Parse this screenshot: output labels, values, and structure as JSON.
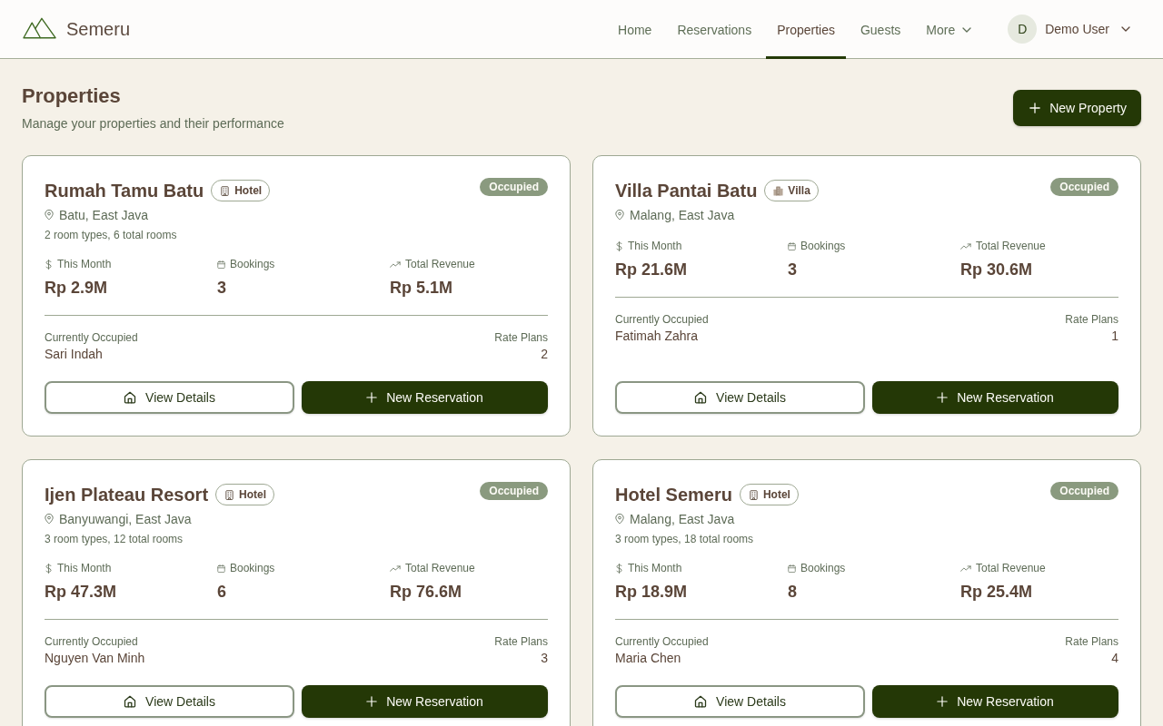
{
  "header": {
    "app_name": "Semeru",
    "nav": [
      {
        "label": "Home",
        "kind": "link",
        "selected": false
      },
      {
        "label": "Reservations",
        "kind": "link",
        "selected": false
      },
      {
        "label": "Properties",
        "kind": "link",
        "selected": true
      },
      {
        "label": "Guests",
        "kind": "link",
        "selected": false
      },
      {
        "label": "More",
        "kind": "menu",
        "selected": false
      }
    ],
    "user": {
      "initial": "D",
      "name": "Demo User"
    }
  },
  "page": {
    "title": "Properties",
    "subtitle": "Manage your properties and their performance",
    "new_button": "New Property"
  },
  "properties": [
    {
      "name": "Rumah Tamu Batu",
      "type": {
        "kind": "hotel",
        "label": "Hotel"
      },
      "status": "Occupied",
      "location": "Batu, East Java",
      "rooms": "2 room types, 6 total rooms",
      "stats": [
        {
          "kind": "money",
          "label": "This Month",
          "value": "Rp 2.9M"
        },
        {
          "kind": "calendar",
          "label": "Bookings",
          "value": "3"
        },
        {
          "kind": "trend",
          "label": "Total Revenue",
          "value": "Rp 5.1M"
        }
      ],
      "occupant_label": "Currently Occupied",
      "occupant": "Sari Indah",
      "rate_plans_label": "Rate Plans",
      "rate_plans": "2",
      "actions": {
        "details": "View Details",
        "reserve": "New Reservation"
      }
    },
    {
      "name": "Villa Pantai Batu",
      "type": {
        "kind": "villa",
        "label": "Villa"
      },
      "status": "Occupied",
      "location": "Malang, East Java",
      "stats": [
        {
          "kind": "money",
          "label": "This Month",
          "value": "Rp 21.6M"
        },
        {
          "kind": "calendar",
          "label": "Bookings",
          "value": "3"
        },
        {
          "kind": "trend",
          "label": "Total Revenue",
          "value": "Rp 30.6M"
        }
      ],
      "occupant_label": "Currently Occupied",
      "occupant": "Fatimah Zahra",
      "rate_plans_label": "Rate Plans",
      "rate_plans": "1",
      "actions": {
        "details": "View Details",
        "reserve": "New Reservation"
      }
    },
    {
      "name": "Ijen Plateau Resort",
      "type": {
        "kind": "hotel",
        "label": "Hotel"
      },
      "status": "Occupied",
      "location": "Banyuwangi, East Java",
      "rooms": "3 room types, 12 total rooms",
      "stats": [
        {
          "kind": "money",
          "label": "This Month",
          "value": "Rp 47.3M"
        },
        {
          "kind": "calendar",
          "label": "Bookings",
          "value": "6"
        },
        {
          "kind": "trend",
          "label": "Total Revenue",
          "value": "Rp 76.6M"
        }
      ],
      "occupant_label": "Currently Occupied",
      "occupant": "Nguyen Van Minh",
      "rate_plans_label": "Rate Plans",
      "rate_plans": "3",
      "actions": {
        "details": "View Details",
        "reserve": "New Reservation"
      }
    },
    {
      "name": "Hotel Semeru",
      "type": {
        "kind": "hotel",
        "label": "Hotel"
      },
      "status": "Occupied",
      "location": "Malang, East Java",
      "rooms": "3 room types, 18 total rooms",
      "stats": [
        {
          "kind": "money",
          "label": "This Month",
          "value": "Rp 18.9M"
        },
        {
          "kind": "calendar",
          "label": "Bookings",
          "value": "8"
        },
        {
          "kind": "trend",
          "label": "Total Revenue",
          "value": "Rp 25.4M"
        }
      ],
      "occupant_label": "Currently Occupied",
      "occupant": "Maria Chen",
      "rate_plans_label": "Rate Plans",
      "rate_plans": "4",
      "actions": {
        "details": "View Details",
        "reserve": "New Reservation"
      }
    }
  ]
}
